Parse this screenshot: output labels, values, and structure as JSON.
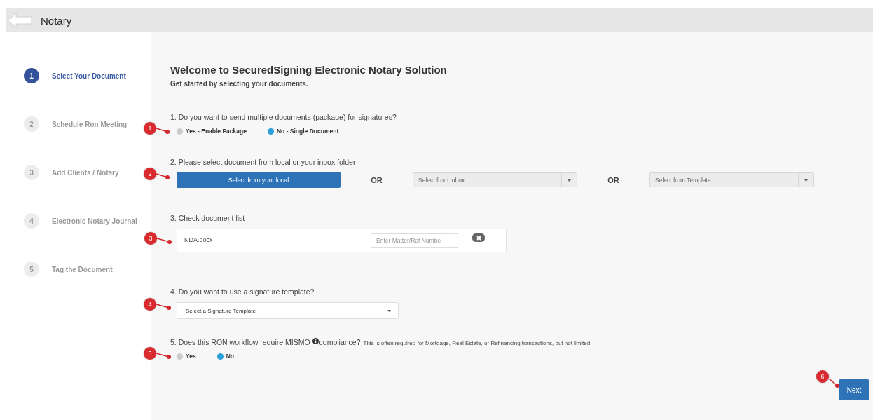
{
  "header": {
    "title": "Notary"
  },
  "steps": [
    {
      "number": "1",
      "label": "Select Your Document",
      "selected": true
    },
    {
      "number": "2",
      "label": "Schedule Ron Meeting",
      "selected": false
    },
    {
      "number": "3",
      "label": "Add Clients / Notary",
      "selected": false
    },
    {
      "number": "4",
      "label": "Electronic Notary Journal",
      "selected": false
    },
    {
      "number": "5",
      "label": "Tag the Document",
      "selected": false
    }
  ],
  "welcome": {
    "title": "Welcome to SecuredSigning Electronic Notary Solution",
    "subtitle": "Get started by selecting your documents."
  },
  "question_1": {
    "callout": "1",
    "prompt": "1. Do you want to send multiple documents (package) for signatures?",
    "options": [
      {
        "label": "Yes - Enable Package",
        "selected": false
      },
      {
        "label": "No - Single Document",
        "selected": true
      }
    ]
  },
  "question_2": {
    "callout": "2",
    "prompt": "2. Please select document from local or your inbox folder",
    "button": "Select from your local",
    "sources": [
      {
        "separator": "OR",
        "placeholder": "Select from Inbox"
      },
      {
        "separator": "OR",
        "placeholder": "Select from Template"
      }
    ]
  },
  "question_3": {
    "callout": "3",
    "prompt": "3. Check document list",
    "documents": [
      {
        "name": "NDA.docx",
        "ref_placeholder": "Enter Matter/Ref Numbe"
      }
    ]
  },
  "question_4": {
    "callout": "4",
    "prompt": "4. Do you want to use a signature template?",
    "placeholder": "Select a Signature Template"
  },
  "question_5": {
    "callout": "5",
    "prompt_start": "5. Does this RON workflow require MISMO",
    "prompt_end": "compliance?",
    "note": "This is often required for Mortgage, Real Estate, or Refinancing transactions, but not limited.",
    "options": [
      {
        "label": "Yes",
        "selected": false
      },
      {
        "label": "No",
        "selected": true
      }
    ]
  },
  "footer": {
    "callout": "6",
    "button": "Next"
  }
}
